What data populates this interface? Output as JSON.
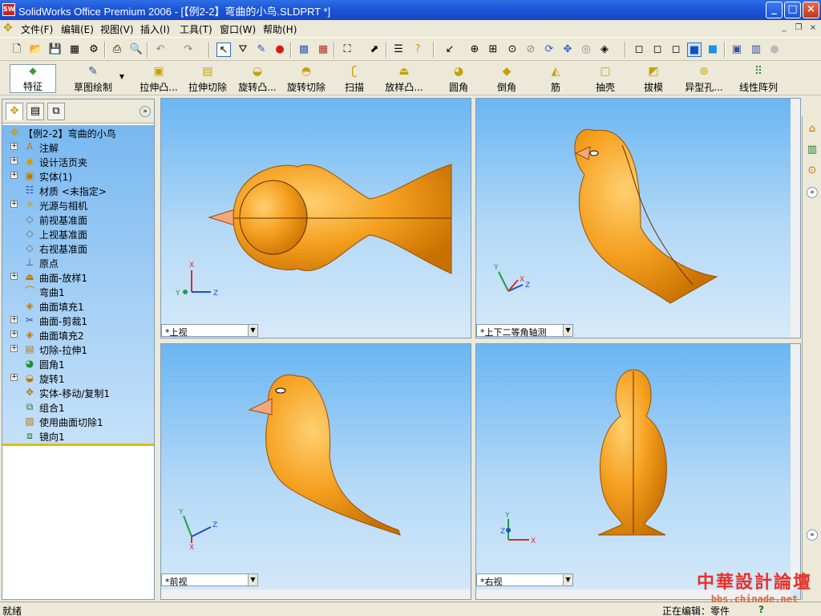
{
  "window": {
    "title": "SolidWorks Office Premium 2006 - [【例2-2】弯曲的小鸟.SLDPRT *]",
    "app_icon": "SW",
    "minimize": "_",
    "maximize": "□",
    "close": "×"
  },
  "menu": {
    "items": [
      "文件(F)",
      "编辑(E)",
      "视图(V)",
      "插入(I)",
      "工具(T)",
      "窗口(W)",
      "帮助(H)"
    ],
    "mdi_controls": [
      "_",
      "❐",
      "×"
    ]
  },
  "feature_toolbar": {
    "main": "特征",
    "sketch": "草图绘制",
    "buttons": [
      "拉伸凸...",
      "拉伸切除",
      "旋转凸...",
      "旋转切除",
      "扫描",
      "放样凸...",
      "圆角",
      "倒角",
      "筋",
      "抽壳",
      "拔模",
      "异型孔...",
      "线性阵列"
    ]
  },
  "feature_manager": {
    "root": "【例2-2】弯曲的小鸟",
    "items": [
      {
        "label": "注解",
        "icon": "annotation-icon",
        "expand": true
      },
      {
        "label": "设计活页夹",
        "icon": "design-binder-icon",
        "expand": true
      },
      {
        "label": "实体(1)",
        "icon": "solid-body-icon",
        "expand": true
      },
      {
        "label": "材质 <未指定>",
        "icon": "material-icon",
        "expand": false
      },
      {
        "label": "光源与相机",
        "icon": "lights-icon",
        "expand": true
      },
      {
        "label": "前视基准面",
        "icon": "plane-icon",
        "expand": false
      },
      {
        "label": "上视基准面",
        "icon": "plane-icon",
        "expand": false
      },
      {
        "label": "右视基准面",
        "icon": "plane-icon",
        "expand": false
      },
      {
        "label": "原点",
        "icon": "origin-icon",
        "expand": false
      },
      {
        "label": "曲面-放样1",
        "icon": "surface-loft-icon",
        "expand": true
      },
      {
        "label": "弯曲1",
        "icon": "flex-icon",
        "expand": false
      },
      {
        "label": "曲面填充1",
        "icon": "surface-fill-icon",
        "expand": false
      },
      {
        "label": "曲面-剪裁1",
        "icon": "surface-trim-icon",
        "expand": true
      },
      {
        "label": "曲面填充2",
        "icon": "surface-fill-icon",
        "expand": true
      },
      {
        "label": "切除-拉伸1",
        "icon": "cut-extrude-icon",
        "expand": true
      },
      {
        "label": "圆角1",
        "icon": "fillet-icon",
        "expand": false
      },
      {
        "label": "旋转1",
        "icon": "revolve-icon",
        "expand": true
      },
      {
        "label": "实体-移动/复制1",
        "icon": "move-copy-icon",
        "expand": false
      },
      {
        "label": "组合1",
        "icon": "combine-icon",
        "expand": false
      },
      {
        "label": "使用曲面切除1",
        "icon": "surface-cut-icon",
        "expand": false
      },
      {
        "label": "镜向1",
        "icon": "mirror-icon",
        "expand": false
      }
    ]
  },
  "viewports": [
    {
      "label": "*上视"
    },
    {
      "label": "*上下二等角轴测"
    },
    {
      "label": "*前视"
    },
    {
      "label": "*右视"
    }
  ],
  "axis": {
    "x": "X",
    "y": "Y",
    "z": "Z"
  },
  "status": {
    "left": "就绪",
    "editing": "正在编辑：零件",
    "help": "?"
  },
  "watermark": {
    "line1": "中華設計論壇",
    "line2": "bbs.chinade.net"
  },
  "colors": {
    "part": "#f5a020",
    "part_dark": "#b86a00",
    "viewport_top": "#6bb6f2",
    "title_bar": "#1c56d8"
  }
}
